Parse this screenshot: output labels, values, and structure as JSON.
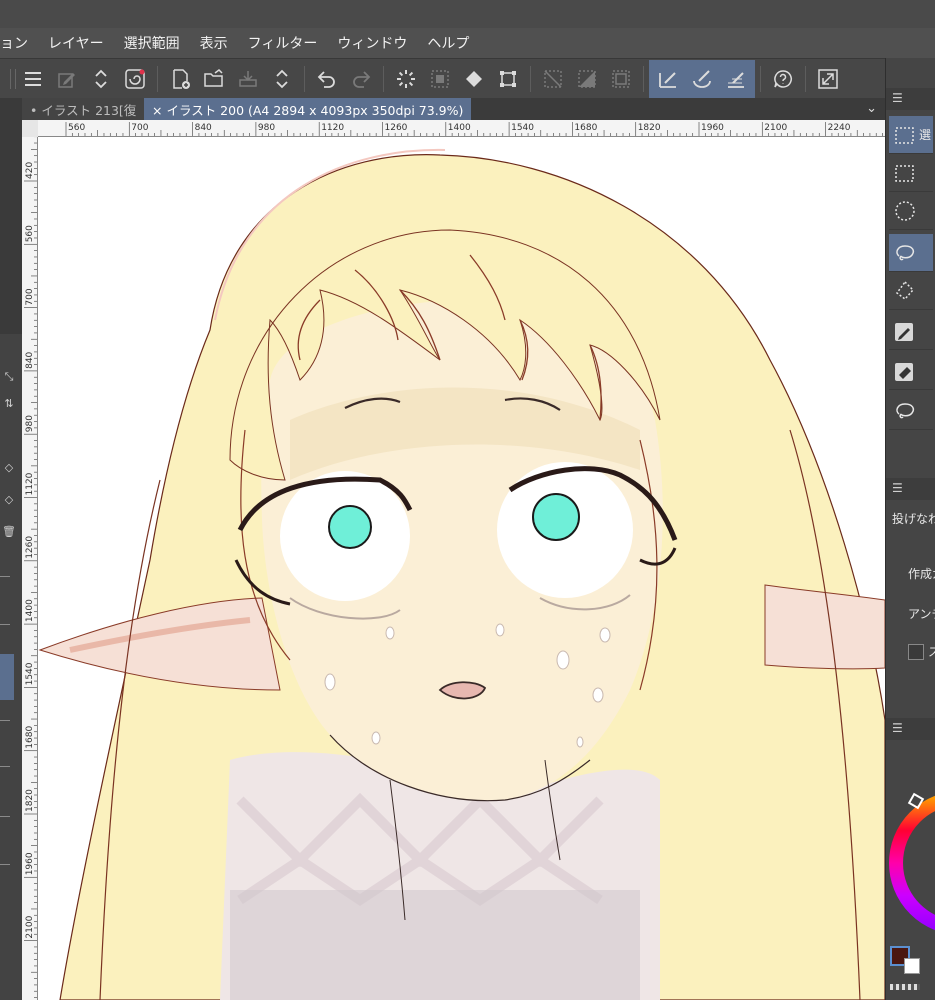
{
  "menu": {
    "items": [
      "ョン",
      "レイヤー",
      "選択範囲",
      "表示",
      "フィルター",
      "ウィンドウ",
      "ヘルプ"
    ]
  },
  "tabs": {
    "inactive_label": "• イラスト 213[復",
    "active_label": "× イラスト 200 (A4 2894 x 4093px 350dpi 73.9%)"
  },
  "ruler": {
    "top_ticks": [
      "560",
      "700",
      "840",
      "980",
      "1120",
      "1260",
      "1400",
      "1540",
      "1680",
      "1820",
      "1960",
      "2100",
      "2240"
    ],
    "left_ticks": [
      "420",
      "560",
      "700",
      "840",
      "980",
      "1120",
      "1260",
      "1400",
      "1540",
      "1680",
      "1820",
      "1960",
      "2100"
    ]
  },
  "right_panel": {
    "tool_label_selected": "選",
    "property_text": "投げなわ",
    "option_create": "作成ガ",
    "option_antialias": "アンチ",
    "option_checkbox": "ス"
  },
  "colors": {
    "accent": "#5b6f8f",
    "main_color": "#4a1710",
    "sub_color": "#ffffff",
    "hair": "#fbf1be",
    "skin": "#fbefd6",
    "eye_iris": "#6fefd8"
  },
  "icons": {
    "toolbar": [
      "menu-icon",
      "pen-settings-icon",
      "swap-icon",
      "layer-icon",
      "new-canvas-icon",
      "open-folder-icon",
      "save-icon",
      "swap-icon",
      "undo-icon",
      "redo-icon",
      "loading-icon",
      "clear-selection-icon",
      "fill-icon",
      "transform-icon",
      "hide-selection-icon",
      "invert-selection-icon",
      "selection-border-icon",
      "snap-ruler-icon",
      "snap-special-ruler-icon",
      "snap-grid-icon",
      "help-icon",
      "fullscreen-icon"
    ]
  }
}
